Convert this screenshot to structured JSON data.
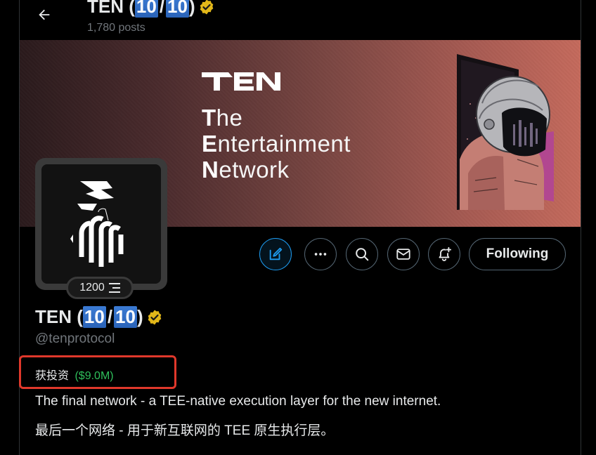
{
  "header": {
    "name_prefix": "TEN (",
    "name_num1": "10",
    "name_sep": "/",
    "name_num2": "10",
    "name_suffix": ")",
    "post_count": "1,780 posts"
  },
  "banner": {
    "logo_text": "TEN",
    "tagline": [
      {
        "initial": "T",
        "rest": "he"
      },
      {
        "initial": "E",
        "rest": "ntertainment"
      },
      {
        "initial": "N",
        "rest": "etwork"
      }
    ]
  },
  "avatar": {
    "score": "1200"
  },
  "actions": {
    "following_label": "Following"
  },
  "profile": {
    "name_prefix": "TEN (",
    "name_num1": "10",
    "name_sep": "/",
    "name_num2": "10",
    "name_suffix": ")",
    "handle": "@tenprotocol",
    "funding_label": "获投资",
    "funding_amount": "($9.0M)",
    "bio_en": "The final network - a TEE-native execution layer for the new internet.",
    "bio_zh": "最后一个网络 - 用于新互联网的 TEE 原生执行层。"
  },
  "colors": {
    "accent": "#1d9bf0",
    "verified_gold": "#e2b719",
    "funding_green": "#2fbf5b",
    "highlight_box_red": "#e0382b"
  },
  "icons": {
    "back": "arrow-left-icon",
    "verified": "verified-badge-icon",
    "edit": "edit-icon",
    "more": "more-icon",
    "search": "search-icon",
    "message": "mail-icon",
    "notify": "bell-plus-icon",
    "score": "list-icon"
  }
}
